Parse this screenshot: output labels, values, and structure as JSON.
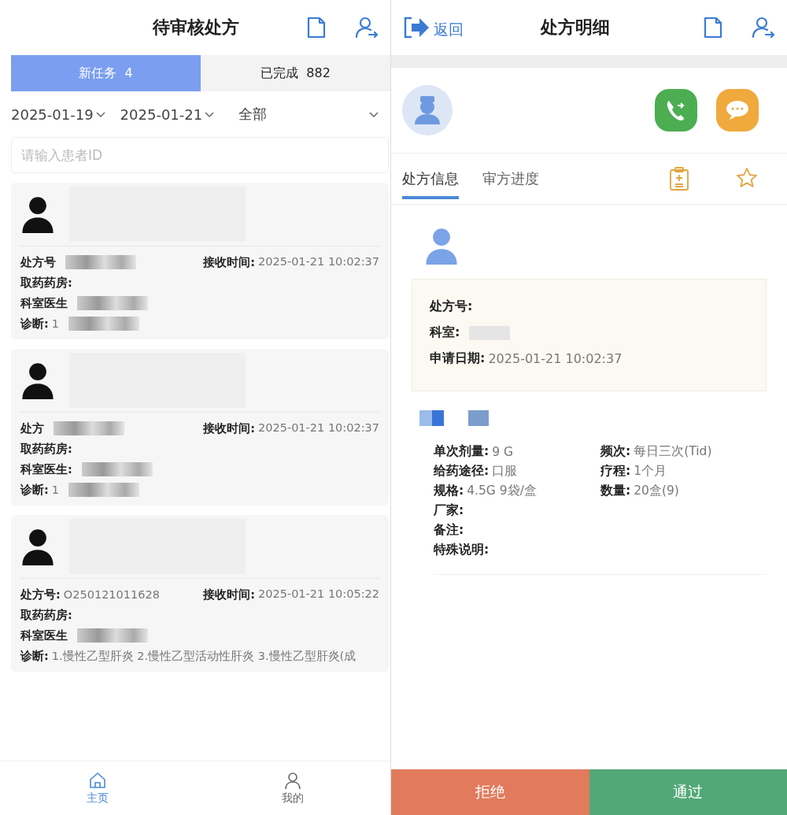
{
  "left_screen": {
    "title": "待审核处方",
    "tabs": [
      {
        "label": "新任务",
        "count": "4",
        "selected": true
      },
      {
        "label": "已完成",
        "count": "882",
        "selected": false
      }
    ],
    "filters": [
      "2025-01-19",
      "2025-01-21",
      "全部"
    ],
    "search": {
      "placeholder": "请输入患者ID"
    },
    "cards": [
      {
        "prescription": {
          "label": "处方号",
          "redacted": true
        },
        "received": {
          "label": "接收时间:",
          "value": "2025-01-21 10:02:37"
        },
        "rows": [
          {
            "label": "取药药房:"
          },
          {
            "label": "科室医生",
            "redacted": true
          },
          {
            "label": "诊断:",
            "value": "1",
            "redacted": true
          }
        ]
      },
      {
        "prescription": {
          "label": "处方",
          "redacted": true
        },
        "received": {
          "label": "接收时间:",
          "value": "2025-01-21 10:02:37"
        },
        "rows": [
          {
            "label": "取药药房:"
          },
          {
            "label": "科室医生:",
            "redacted": true
          },
          {
            "label": "诊断:",
            "value": "1",
            "redacted": true
          }
        ]
      },
      {
        "prescription": {
          "label": "处方号:",
          "value": "O250121011628"
        },
        "received": {
          "label": "接收时间:",
          "value": "2025-01-21 10:05:22"
        },
        "rows": [
          {
            "label": "取药药房:"
          },
          {
            "label": "科室医生",
            "redacted": true
          },
          {
            "label": "诊断:",
            "value": "1.慢性乙型肝炎 2.慢性乙型活动性肝炎 3.慢性乙型肝炎(成"
          }
        ]
      }
    ],
    "bottom_nav": [
      {
        "label": "主页",
        "kind": "home",
        "selected": true
      },
      {
        "label": "我的",
        "kind": "profile",
        "selected": false
      }
    ]
  },
  "right_screen": {
    "back": "返回",
    "title": "处方明细",
    "tabs": [
      {
        "label": "处方信息",
        "selected": true
      },
      {
        "label": "审方进度",
        "selected": false
      }
    ],
    "info": [
      {
        "label": "处方号:"
      },
      {
        "label": "科室:",
        "redacted": true
      },
      {
        "label": "申请日期:",
        "value": "2025-01-21 10:02:37"
      }
    ],
    "details": [
      {
        "label": "单次剂量:",
        "value": "9 G",
        "kind": "half"
      },
      {
        "label": "频次:",
        "value": "每日三次(Tid)",
        "kind": "half"
      },
      {
        "label": "给药途径:",
        "value": "口服",
        "kind": "half"
      },
      {
        "label": "疗程:",
        "value": "1个月",
        "kind": "half"
      },
      {
        "label": "规格:",
        "value": "4.5G 9袋/盒",
        "kind": "half"
      },
      {
        "label": "数量:",
        "value": "20盒(9)",
        "kind": "half"
      },
      {
        "label": "厂家:",
        "kind": "full"
      },
      {
        "label": "备注:",
        "kind": "full"
      },
      {
        "label": "特殊说明:",
        "kind": "full"
      }
    ],
    "buttons": [
      {
        "label": "拒绝",
        "kind": "reject"
      },
      {
        "label": "通过",
        "kind": "approve"
      }
    ]
  }
}
